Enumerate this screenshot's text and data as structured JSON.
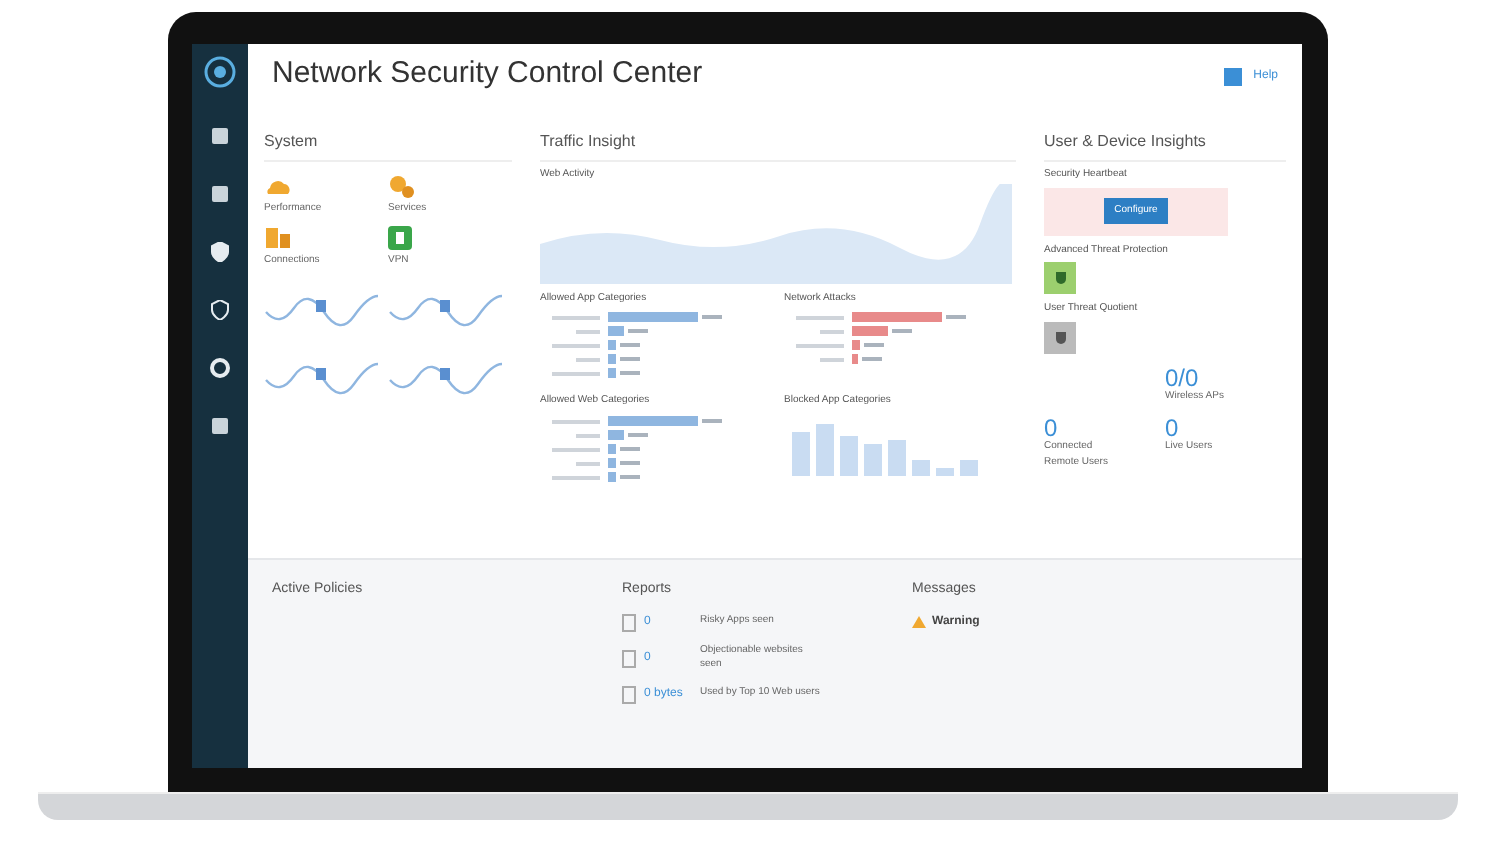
{
  "header": {
    "title": "Network Security Control Center",
    "help": "Help"
  },
  "system": {
    "title": "System",
    "tiles": [
      {
        "label": "Performance",
        "kind": "gauge"
      },
      {
        "label": "Services",
        "kind": "gears"
      },
      {
        "label": "Connections",
        "kind": "network"
      },
      {
        "label": "VPN",
        "kind": "vpn"
      }
    ]
  },
  "traffic": {
    "title": "Traffic Insight",
    "web_activity": "Web Activity",
    "panels": [
      {
        "title": "Allowed App Categories",
        "kind": "blue"
      },
      {
        "title": "Network Attacks",
        "kind": "red"
      },
      {
        "title": "Allowed Web Categories",
        "kind": "blue"
      },
      {
        "title": "Blocked App Categories",
        "kind": "columns"
      }
    ]
  },
  "user": {
    "title": "User & Device Insights",
    "heartbeat": "Security Heartbeat",
    "configure": "Configure",
    "atp": "Advanced Threat Protection",
    "utq": "User Threat Quotient",
    "stats": [
      {
        "value": "0/0",
        "label": "Wireless APs"
      },
      {
        "value": "0",
        "label": "Connected Remote Users"
      },
      {
        "value": "0",
        "label": "Live Users"
      }
    ]
  },
  "policies": {
    "title": "Active Policies"
  },
  "reports": {
    "title": "Reports",
    "items": [
      {
        "value": "0",
        "desc": "Risky Apps seen"
      },
      {
        "value": "0",
        "desc": "Objectionable websites seen"
      },
      {
        "value": "0 bytes",
        "desc": "Used by Top 10 Web users"
      }
    ]
  },
  "messages": {
    "title": "Messages",
    "items": [
      {
        "kind": "warning",
        "title": "Warning"
      }
    ]
  }
}
